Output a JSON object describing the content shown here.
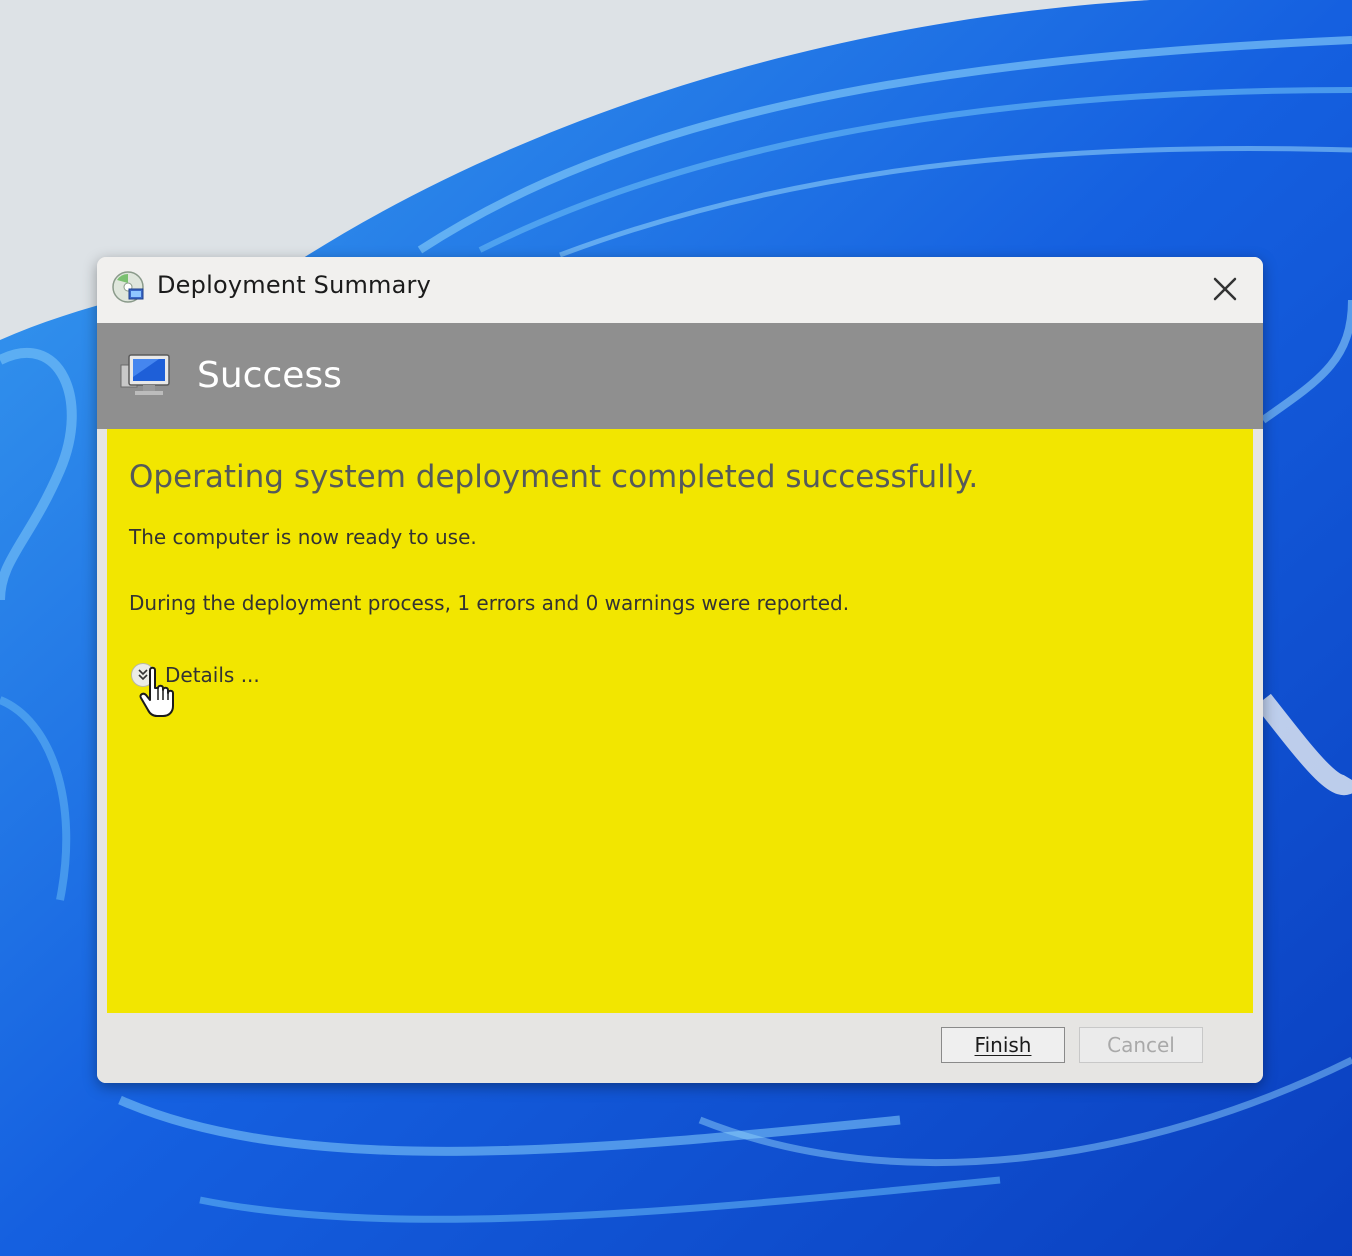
{
  "window": {
    "title": "Deployment Summary",
    "title_icon": "deployment-disc-icon",
    "close_icon": "close-icon"
  },
  "banner": {
    "status": "Success",
    "icon": "computer-monitor-icon",
    "background": "#8f8f8f"
  },
  "content": {
    "background": "#f2e600",
    "headline": "Operating system deployment completed successfully.",
    "ready_text": "The computer is now ready to use.",
    "report_text": "During the deployment process, 1 errors and 0 warnings were reported.",
    "details_label": "Details ...",
    "details_icon": "chevron-double-down-icon"
  },
  "footer": {
    "finish_label": "Finish",
    "cancel_label": "Cancel"
  },
  "wallpaper": {
    "accent": "#1a6fe8"
  }
}
